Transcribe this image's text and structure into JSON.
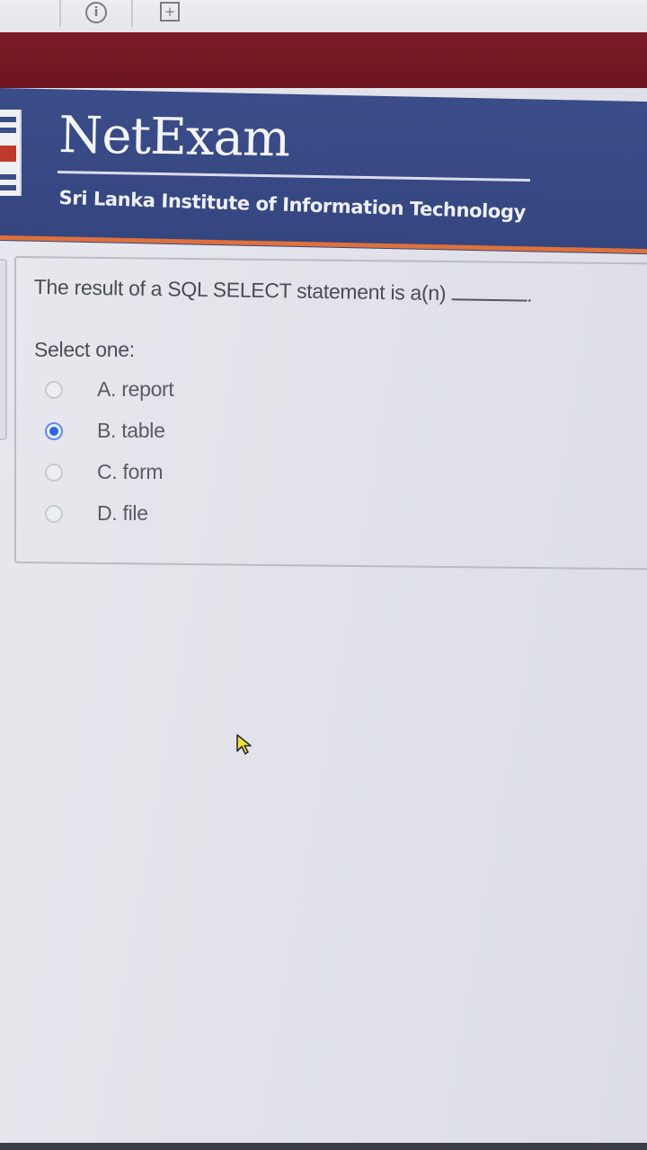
{
  "header": {
    "brand": "NetExam",
    "subtitle": "Sri Lanka Institute of Information Technology"
  },
  "question": {
    "text": "The result of a SQL SELECT statement is a(n)",
    "suffix": ".",
    "prompt": "Select one:",
    "options": [
      {
        "label": "A. report",
        "selected": false
      },
      {
        "label": "B. table",
        "selected": true
      },
      {
        "label": "C. form",
        "selected": false
      },
      {
        "label": "D. file",
        "selected": false
      }
    ]
  },
  "colors": {
    "header_blue": "#3b4d88",
    "maroon_band": "#7b1a24",
    "accent_orange": "#e0713a",
    "radio_selected": "#2b66e0"
  },
  "icons": {
    "browser_info": "info-icon",
    "browser_new_tab": "new-tab-icon",
    "pointer": "mouse-pointer-icon"
  }
}
